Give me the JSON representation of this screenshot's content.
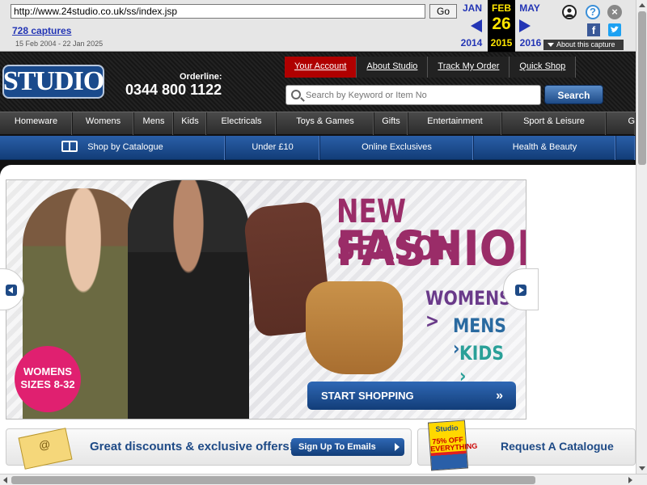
{
  "wayback": {
    "url": "http://www.24studio.co.uk/ss/index.jsp",
    "go_label": "Go",
    "captures": "728 captures",
    "range": "15 Feb 2004 - 22 Jan 2025",
    "prev": {
      "month": "JAN",
      "year": "2014"
    },
    "current": {
      "month": "FEB",
      "day": "26",
      "year": "2015"
    },
    "next": {
      "month": "MAY",
      "year": "2016"
    },
    "about": "About this capture",
    "icons": [
      "user-icon",
      "help-icon",
      "close-icon",
      "facebook-icon",
      "twitter-icon"
    ]
  },
  "header": {
    "logo_text": "STUDIO",
    "orderline_label": "Orderline:",
    "orderline_number": "0344 800 1122",
    "top_links": [
      "Your Account",
      "About Studio",
      "Track My Order",
      "Quick Shop"
    ],
    "search_placeholder": "Search by Keyword or Item No",
    "search_button": "Search"
  },
  "nav": {
    "items": [
      "Homeware",
      "Womens",
      "Mens",
      "Kids",
      "Electricals",
      "Toys & Games",
      "Gifts",
      "Entertainment",
      "Sport & Leisure",
      "G"
    ]
  },
  "catalogue_nav": {
    "items": [
      "Shop by Catalogue",
      "Under £10",
      "Online Exclusives",
      "Health & Beauty"
    ]
  },
  "hero": {
    "title_line1": "NEW SEASON",
    "title_line2": "FASHION",
    "links": [
      "WOMENS >",
      "MENS",
      "KIDS"
    ],
    "badge_line1": "WOMENS",
    "badge_line2": "SIZES 8-32",
    "cta": "START SHOPPING"
  },
  "promos": {
    "offers_text": "Great discounts & exclusive offers!",
    "signup_button": "Sign Up To Emails",
    "catalogue_cover_top": "Studio",
    "catalogue_cover_offer": "75% OFF EVERYTHING",
    "request_catalogue": "Request A Catalogue"
  },
  "colors": {
    "accent_blue": "#1e4a86",
    "active_link_red": "#b00000",
    "hero_magenta": "#9a2c68",
    "wayback_blue": "#2335b5",
    "wayback_yellow": "#ffe600"
  }
}
